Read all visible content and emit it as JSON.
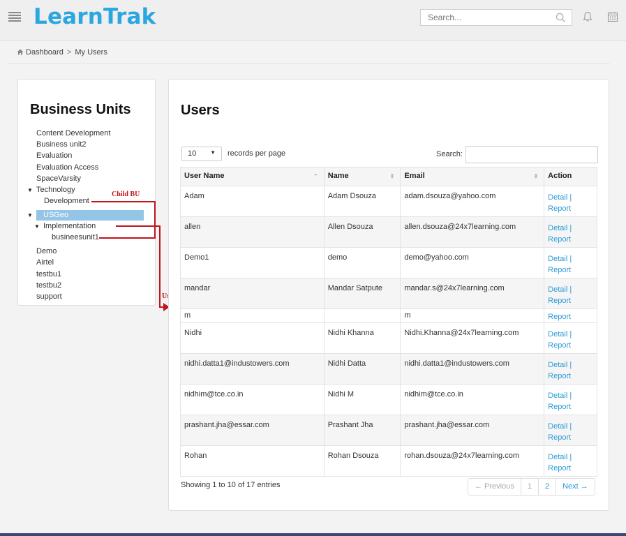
{
  "header": {
    "logo": "LearnTrak",
    "search_placeholder": "Search..."
  },
  "breadcrumb": {
    "home": "Dashboard",
    "separator": ">",
    "current": "My Users"
  },
  "business_units": {
    "title": "Business Units",
    "items": [
      {
        "label": "Content Development"
      },
      {
        "label": "Business unit2"
      },
      {
        "label": "Evaluation"
      },
      {
        "label": "Evaluation Access"
      },
      {
        "label": "SpaceVarsity"
      },
      {
        "label": "Technology"
      },
      {
        "label": "Development"
      },
      {
        "label": "USGeo"
      },
      {
        "label": "Implementation"
      },
      {
        "label": "busineesunit1"
      },
      {
        "label": "Demo"
      },
      {
        "label": "Airtel"
      },
      {
        "label": "testbu1"
      },
      {
        "label": "testbu2"
      },
      {
        "label": "support"
      }
    ],
    "selected": "USGeo"
  },
  "annotations": {
    "child_bu": "Child BU",
    "users": "Users",
    "color": "#c0141c"
  },
  "users": {
    "title": "Users",
    "records_per_page_value": "10",
    "records_per_page_label": "records per page",
    "search_label": "Search:",
    "columns": [
      "User Name",
      "Name",
      "Email",
      "Action"
    ],
    "rows": [
      {
        "username": "Adam",
        "name": "Adam Dsouza",
        "email": "adam.dsouza@yahoo.com",
        "detail": "Detail |",
        "report": "Report"
      },
      {
        "username": "allen",
        "name": "Allen Dsouza",
        "email": "allen.dsouza@24x7learning.com",
        "detail": "Detail |",
        "report": "Report"
      },
      {
        "username": "Demo1",
        "name": "demo",
        "email": "demo@yahoo.com",
        "detail": "Detail |",
        "report": "Report"
      },
      {
        "username": "mandar",
        "name": "Mandar Satpute",
        "email": "mandar.s@24x7learning.com",
        "detail": "Detail |",
        "report": "Report"
      },
      {
        "username": "m",
        "name": "",
        "email": "m",
        "detail": "",
        "report": "Report"
      },
      {
        "username": "Nidhi",
        "name": "Nidhi Khanna",
        "email": "Nidhi.Khanna@24x7learning.com",
        "detail": "Detail |",
        "report": "Report"
      },
      {
        "username": "nidhi.datta1@industowers.com",
        "name": "Nidhi Datta",
        "email": "nidhi.datta1@industowers.com",
        "detail": "Detail |",
        "report": "Report"
      },
      {
        "username": "nidhim@tce.co.in",
        "name": "Nidhi M",
        "email": "nidhim@tce.co.in",
        "detail": "Detail |",
        "report": "Report"
      },
      {
        "username": "prashant.jha@essar.com",
        "name": "Prashant Jha",
        "email": "prashant.jha@essar.com",
        "detail": "Detail |",
        "report": "Report"
      },
      {
        "username": "Rohan",
        "name": "Rohan Dsouza",
        "email": "rohan.dsouza@24x7learning.com",
        "detail": "Detail |",
        "report": "Report"
      }
    ],
    "showing": "Showing 1 to 10 of 17 entries",
    "pagination": {
      "previous": "← Previous",
      "pages": [
        "1",
        "2"
      ],
      "next": "Next →"
    }
  },
  "colors": {
    "brand": "#2aa7e0",
    "link": "#2a9ad6",
    "selected_bu": "#94c4e6"
  }
}
